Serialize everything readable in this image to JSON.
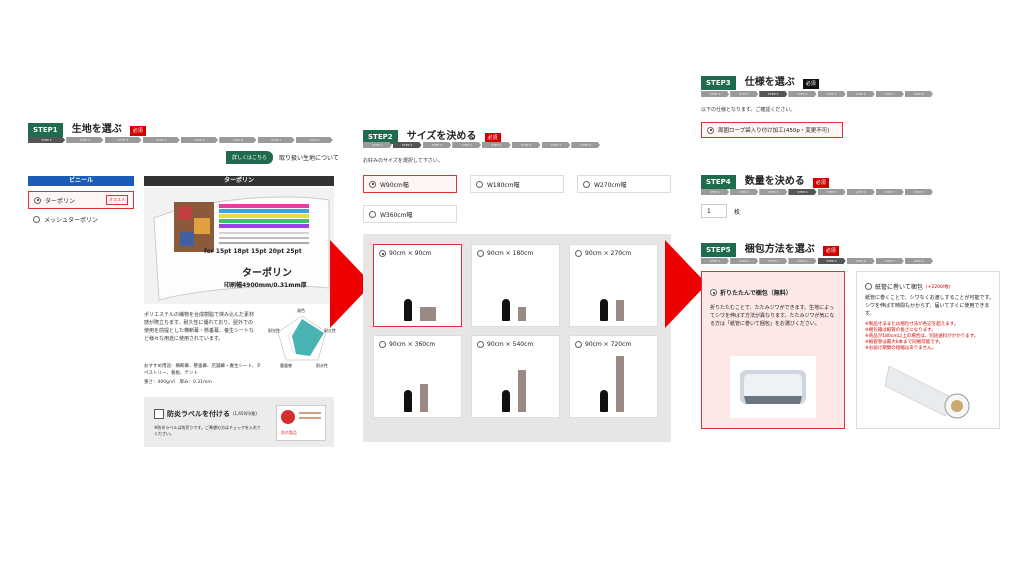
{
  "step1": {
    "badge": "STEP1",
    "title": "生地を選ぶ",
    "required": "必須",
    "progress": [
      "STEP 1",
      "STEP 2",
      "STEP 3",
      "STEP 4",
      "STEP 5",
      "STEP 6",
      "STEP 7",
      "STEP 8"
    ],
    "samples_btn": "詳しくはこちら",
    "samples_link": "取り扱い生地について",
    "tab_left": "ビニール",
    "tab_right": "ターポリン",
    "options": [
      {
        "label": "ターポリン",
        "badge": "オススメ",
        "selected": true
      },
      {
        "label": "メッシュターポリン",
        "selected": false
      }
    ],
    "image_text_1": "ターポリン",
    "image_text_2": "印刷幅4900mm/0.31mm厚",
    "image_text_3": "for 15pt 18pt 15pt 20pt 25pt",
    "description": "ポリエステルの織物を合成樹脂で挟み込んだ素材感が際立ちます。耐久性に優れており、屋外での使用を前提とした横断幕・懸垂幕、養生シートなど様々な用途に使用されています。",
    "usage": "おすすめ用途：横断幕、懸垂幕、店舗幕・養生シート、タペストリー、看板、テント",
    "spec": "重さ：400g/㎡　厚み：0.31mm",
    "radar_labels": [
      "発色",
      "耐久性",
      "耐水性",
      "重量感",
      "耐光性"
    ],
    "label_option": "防炎ラベルを付ける",
    "label_price": "(1,650円/枚)",
    "label_note": "※防炎ラベルは別売りです。ご希望の方はチェックを入れてください。",
    "label_img_text": "防炎製品"
  },
  "step2": {
    "badge": "STEP2",
    "title": "サイズを決める",
    "required": "必須",
    "progress": [
      "STEP 1",
      "STEP 2",
      "STEP 3",
      "STEP 4",
      "STEP 5",
      "STEP 6",
      "STEP 7",
      "STEP 8"
    ],
    "instruction": "お好みのサイズを選択して下さい。",
    "widths": [
      {
        "label": "W90cm幅",
        "selected": true
      },
      {
        "label": "W180cm幅",
        "selected": false
      },
      {
        "label": "W270cm幅",
        "selected": false
      },
      {
        "label": "W360cm幅",
        "selected": false
      }
    ],
    "sizes": [
      {
        "label": "90cm × 90cm",
        "selected": true,
        "h": 0.125
      },
      {
        "label": "90cm × 180cm",
        "selected": false,
        "h": 0.25
      },
      {
        "label": "90cm × 270cm",
        "selected": false,
        "h": 0.375
      },
      {
        "label": "90cm × 360cm",
        "selected": false,
        "h": 0.5
      },
      {
        "label": "90cm × 540cm",
        "selected": false,
        "h": 0.75
      },
      {
        "label": "90cm × 720cm",
        "selected": false,
        "h": 1.0
      }
    ]
  },
  "step3": {
    "badge": "STEP3",
    "title": "仕様を選ぶ",
    "required": "必須",
    "progress": [
      "STEP 1",
      "STEP 2",
      "STEP 3",
      "STEP 4",
      "STEP 5",
      "STEP 6",
      "STEP 7",
      "STEP 8"
    ],
    "instruction": "以下の仕様となります。ご確認ください。",
    "option": "周囲ロープ袋入り付け加工(450p・変更不可)"
  },
  "step4": {
    "badge": "STEP4",
    "title": "数量を決める",
    "required": "必須",
    "progress": [
      "STEP 1",
      "STEP 2",
      "STEP 3",
      "STEP 4",
      "STEP 5",
      "STEP 6",
      "STEP 7",
      "STEP 8"
    ],
    "quantity": "1",
    "unit": "枚"
  },
  "step5": {
    "badge": "STEP5",
    "title": "梱包方法を選ぶ",
    "required": "必須",
    "progress": [
      "STEP 1",
      "STEP 2",
      "STEP 3",
      "STEP 4",
      "STEP 5",
      "STEP 6",
      "STEP 7",
      "STEP 8"
    ],
    "opt1_title": "折りたたんで梱包（無料）",
    "opt1_desc": "折りたたむことで、たたみジワができます。生地によってシワを伸ばす方法が異なります。たたみジワが気になる方は「紙管に巻いて梱包」をお選びください。",
    "opt2_title": "紙管に巻いて梱包",
    "opt2_price": "(+2200/枚)",
    "opt2_desc": "紙管に巻くことで、シワなくお渡しすることが可能です。シワを伸ばす時間もかからず、届いてすぐに使用できます。",
    "opt2_notes": [
      "※製品寸法または梱包寸法が各辺を超えます。",
      "※梱包箱は紙管の長さになります。",
      "※商品が180cm以上の場合は、別途送料がかかります。",
      "※紙管巻は最大6本まで同梱可能です。",
      "※お届け期間の短縮はありません。"
    ]
  },
  "colors": {
    "accent": "#1e6b4e",
    "required": "#d40000",
    "arrow": "#ee0000",
    "selected_border": "#e03030"
  }
}
